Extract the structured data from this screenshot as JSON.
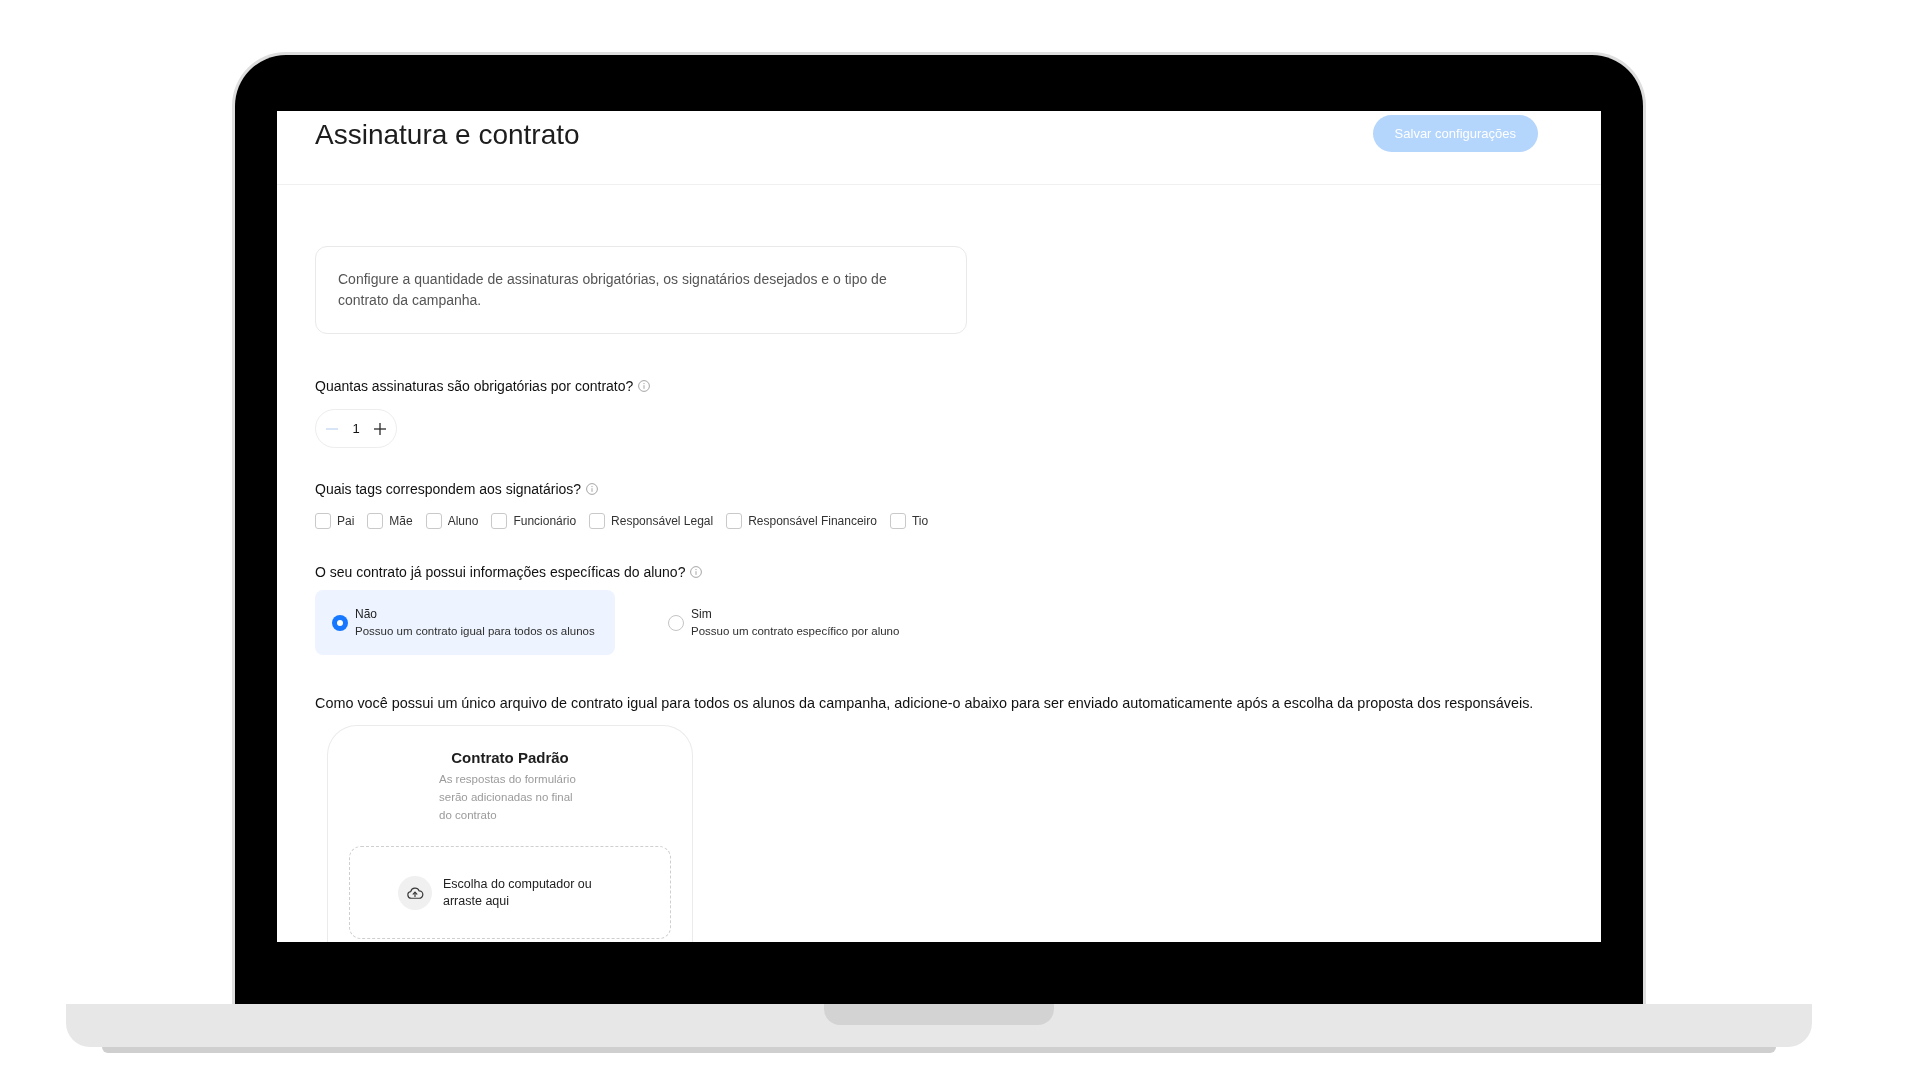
{
  "header": {
    "title": "Assinatura e contrato",
    "save_button": {
      "label": "Salvar configurações",
      "disabled": true
    }
  },
  "intro": "Configure a quantidade de assinaturas obrigatórias, os signatários desejados e o tipo de contrato da campanha.",
  "signature_count": {
    "label": "Quantas assinaturas são obrigatórias por contrato?",
    "value": "1",
    "decrement_disabled": true
  },
  "signer_tags": {
    "label": "Quais tags correspondem aos signatários?",
    "options": [
      {
        "label": "Pai",
        "checked": false
      },
      {
        "label": "Mãe",
        "checked": false
      },
      {
        "label": "Aluno",
        "checked": false
      },
      {
        "label": "Funcionário",
        "checked": false
      },
      {
        "label": "Responsável Legal",
        "checked": false
      },
      {
        "label": "Responsável Financeiro",
        "checked": false
      },
      {
        "label": "Tio",
        "checked": false
      }
    ]
  },
  "contract_type": {
    "label": "O seu contrato já possui informações específicas do aluno?",
    "options": [
      {
        "title": "Não",
        "description": "Possuo um contrato igual para todos os alunos",
        "selected": true
      },
      {
        "title": "Sim",
        "description": "Possuo um contrato específico por aluno",
        "selected": false
      }
    ]
  },
  "upload_note": "Como você possui um único arquivo de contrato igual para todos os alunos da campanha, adicione-o abaixo para ser enviado automaticamente após a escolha da proposta dos responsáveis.",
  "contract_card": {
    "title": "Contrato Padrão",
    "note": "As respostas do formulário serão adicionadas no final do contrato",
    "dropzone_text": "Escolha do computador ou arraste aqui"
  }
}
